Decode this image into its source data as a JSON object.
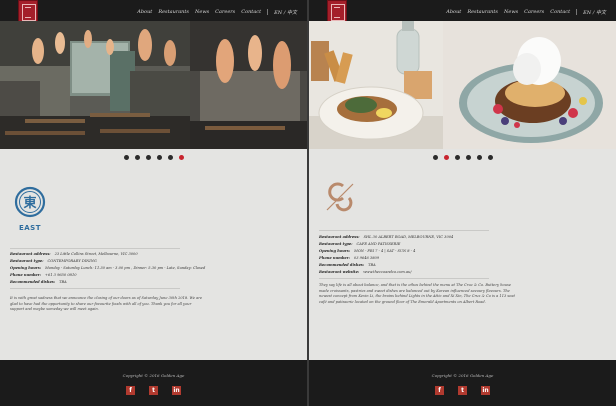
{
  "nav": {
    "items": [
      "About",
      "Restaurants",
      "News",
      "Careers",
      "Contact"
    ],
    "lang": "EN / 中文"
  },
  "left": {
    "brand_text": "EAST",
    "brand_char": "東",
    "info": [
      {
        "label": "Restaurant address:",
        "value": "23 Little Collins Street, Melbourne, VIC 3000"
      },
      {
        "label": "Restaurant type:",
        "value": "CONTEMPORARY DINING"
      },
      {
        "label": "Opening hours:",
        "value": "Monday - Saturday Lunch: 11.30 am - 3.00 pm , Dinner: 5.30 pm - Late, Sunday: Closed"
      },
      {
        "label": "Phone number:",
        "value": "+61 3 9650 0810"
      },
      {
        "label": "Recommended dishes:",
        "value": "TBA"
      }
    ],
    "description": [
      "It is with great sadness that we announce the closing of our doors as of Saturday June 30th 2018. We are",
      "glad to have had the opportunity to share our favourite foods with all of you. Thank you for all your",
      "support and maybe someday we will meet again."
    ],
    "active_dot": 5
  },
  "right": {
    "info": [
      {
        "label": "Restaurant address:",
        "value": "SHL 30 ALBERT ROAD, MELBOURNE, VIC 3004"
      },
      {
        "label": "Restaurant type:",
        "value": "CAFE AND PATISSERIE"
      },
      {
        "label": "Opening hours:",
        "value": "MON - FRI 7 - 4 | SAT - SUN 8 - 4"
      },
      {
        "label": "Phone number:",
        "value": "03 9646 3809"
      },
      {
        "label": "Recommended dishes:",
        "value": "TBA"
      },
      {
        "label": "Restaurant website:",
        "value": "www.theccoandco.com.au/"
      }
    ],
    "description": [
      "They say life is all about balance, and that is the ethos behind the menu at The Cruz & Co. Buttery house",
      "made croissants, pastries and sweet dishes are balanced out by Korean influenced savoury flavours. The",
      "newest concept from Kevin Li, the brains behind Lights in the Attic and Xi Xin, The Cruz & Co is a 113 seat",
      "café and patisserie located on the ground floor of The Emerald Apartments on Albert Road."
    ],
    "active_dot": 1
  },
  "footer": {
    "copyright": "Copyright © 2016 Golden Age",
    "social": [
      {
        "icon": "facebook-icon",
        "glyph": "f"
      },
      {
        "icon": "twitter-icon",
        "glyph": "t"
      },
      {
        "icon": "linkedin-icon",
        "glyph": "in"
      }
    ]
  },
  "colors": {
    "brand_red": "#a41f2a",
    "east_blue": "#2f6d9e",
    "cc_copper": "#b98a6c",
    "dot_active": "#c8242e"
  }
}
